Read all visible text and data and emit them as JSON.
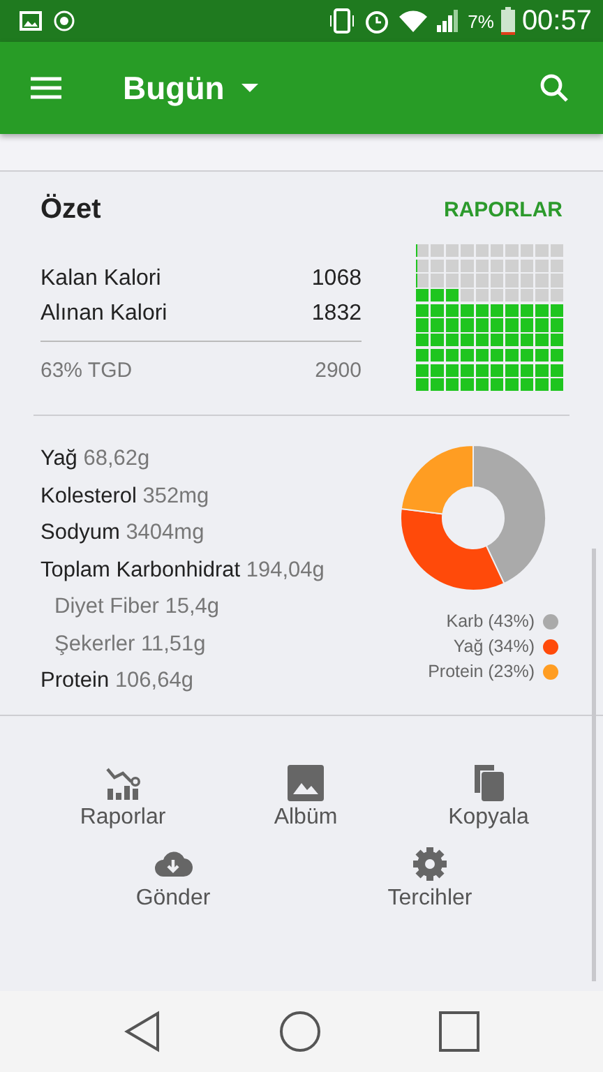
{
  "app_bar": {
    "title": "Bugün"
  },
  "summary": {
    "title": "Özet",
    "reports_link": "RAPORLAR",
    "rows": [
      {
        "label": "Kalan Kalori",
        "value": "1068"
      },
      {
        "label": "Alınan Kalori",
        "value": "1832"
      }
    ],
    "goal": {
      "label": "63% TGD",
      "value": "2900"
    },
    "waffle": {
      "rows": [
        {
          "level": 0
        },
        {
          "level": 0
        },
        {
          "level": 0
        },
        {
          "level": 0.3
        },
        {
          "level": 1
        },
        {
          "level": 1
        },
        {
          "level": 1
        },
        {
          "level": 1
        },
        {
          "level": 1
        },
        {
          "level": 1
        }
      ]
    }
  },
  "nutrients": [
    {
      "kind": "main",
      "name": "Yağ",
      "value": "68,62g"
    },
    {
      "kind": "main",
      "name": "Kolesterol",
      "value": "352mg"
    },
    {
      "kind": "main",
      "name": "Sodyum",
      "value": "3404mg"
    },
    {
      "kind": "main",
      "name": "Toplam Karbonhidrat",
      "value": "194,04g"
    },
    {
      "kind": "sub",
      "name": "Diyet Fiber",
      "value": "15,4g"
    },
    {
      "kind": "sub",
      "name": "Şekerler",
      "value": "11,51g"
    },
    {
      "kind": "main",
      "name": "Protein",
      "value": "106,64g"
    }
  ],
  "macros": {
    "chart_data": {
      "type": "donut",
      "categories": [
        "Karb (43%)",
        "Yağ (34%)",
        "Protein (23%)"
      ],
      "series": [
        {
          "values": [
            43,
            34,
            23
          ]
        }
      ],
      "colors": [
        "#aaaaaa",
        "#ff4a0a",
        "#ff9d22"
      ]
    }
  },
  "actions": [
    {
      "kind": "reports",
      "label": "Raporlar"
    },
    {
      "kind": "album",
      "label": "Albüm"
    },
    {
      "kind": "copy",
      "label": "Kopyala"
    },
    {
      "kind": "upload",
      "label": "Gönder"
    },
    {
      "kind": "settings",
      "label": "Tercihler"
    }
  ],
  "status_bar": {
    "battery": "7%",
    "time": "00:57"
  }
}
